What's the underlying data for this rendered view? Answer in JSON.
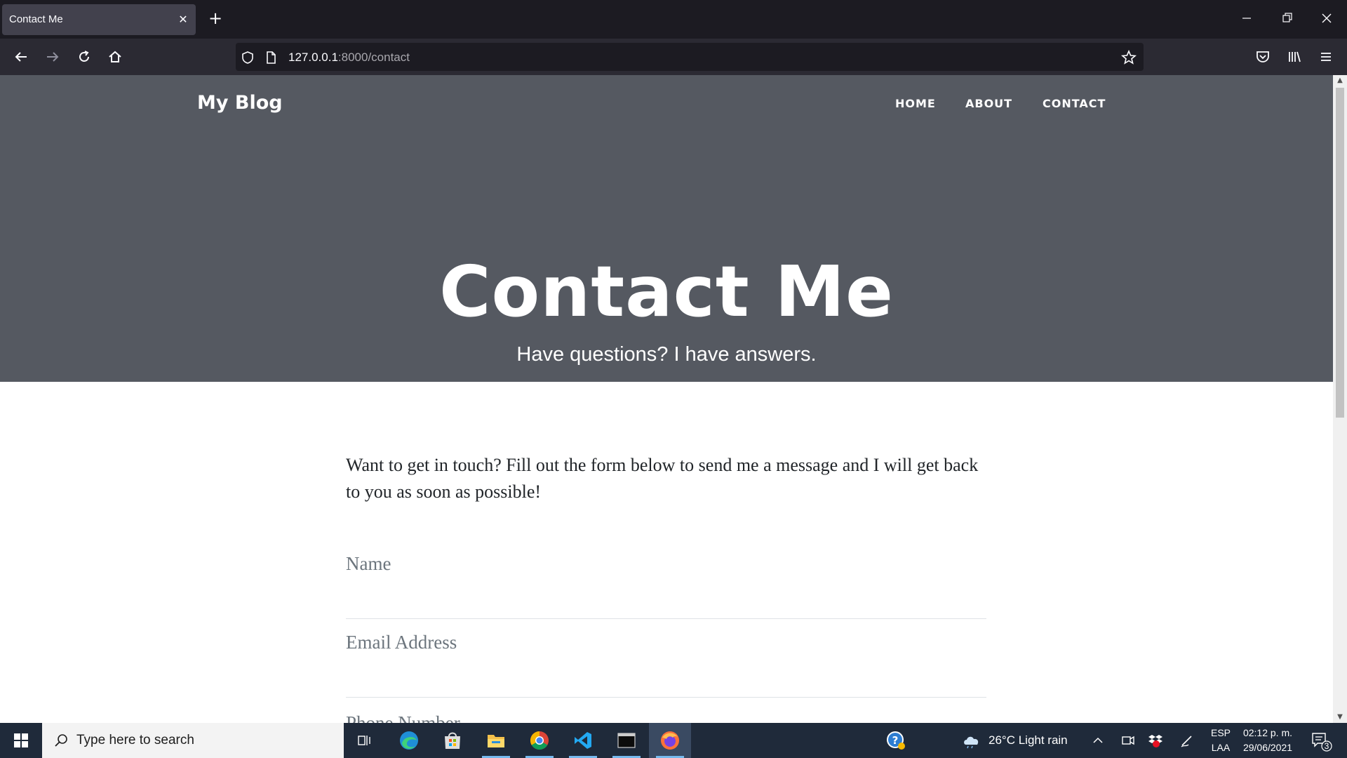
{
  "browser": {
    "tab_title": "Contact Me",
    "tab_close": "✕",
    "new_tab": "+",
    "url_host": "127.0.0.1",
    "url_path": ":8000/contact"
  },
  "site": {
    "brand": "My Blog",
    "nav": [
      {
        "label": "HOME"
      },
      {
        "label": "ABOUT"
      },
      {
        "label": "CONTACT"
      }
    ],
    "hero_title": "Contact Me",
    "hero_subtitle": "Have questions? I have answers.",
    "intro": "Want to get in touch? Fill out the form below to send me a message and I will get back to you as soon as possible!",
    "form": {
      "name_placeholder": "Name",
      "email_placeholder": "Email Address",
      "phone_placeholder": "Phone Number"
    }
  },
  "taskbar": {
    "search_placeholder": "Type here to search",
    "weather": "26°C  Light rain",
    "lang_top": "ESP",
    "lang_bottom": "LAA",
    "time": "02:12 p. m.",
    "date": "29/06/2021",
    "notifications": "3"
  },
  "colors": {
    "hero_bg": "#555961",
    "titlebar": "#1c1b22",
    "toolbar": "#2b2a33",
    "taskbar": "#1f2a3a"
  }
}
